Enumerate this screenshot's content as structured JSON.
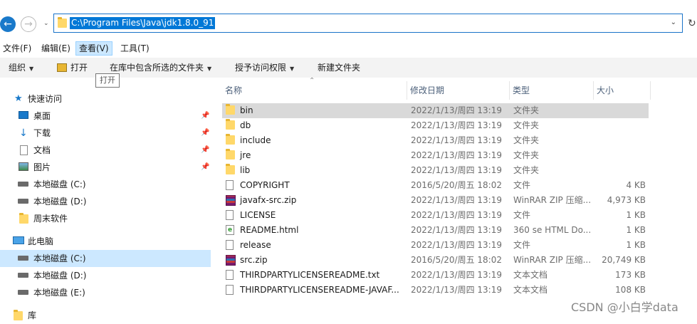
{
  "address": {
    "path": "C:\\Program Files\\Java\\jdk1.8.0_91"
  },
  "menu": {
    "items": [
      "文件(F)",
      "编辑(E)",
      "查看(V)",
      "工具(T)"
    ]
  },
  "command_bar": {
    "organize": "组织",
    "open": "打开",
    "include_in_library": "在库中包含所选的文件夹",
    "grant_access": "授予访问权限",
    "new_folder": "新建文件夹",
    "tooltip": "打开"
  },
  "nav": {
    "quick_access": "快速访问",
    "desktop": "桌面",
    "downloads": "下载",
    "documents": "文档",
    "pictures": "图片",
    "qa_drive_c": "本地磁盘 (C:)",
    "qa_drive_d": "本地磁盘 (D:)",
    "weekend": "周末软件",
    "this_pc": "此电脑",
    "drive_c": "本地磁盘 (C:)",
    "drive_d": "本地磁盘 (D:)",
    "drive_e": "本地磁盘 (E:)",
    "library": "库"
  },
  "columns": {
    "name": "名称",
    "date": "修改日期",
    "type": "类型",
    "size": "大小"
  },
  "files": [
    {
      "name": "bin",
      "date": "2022/1/13/周四 13:19",
      "type": "文件夹",
      "size": "",
      "icon": "folder-icon"
    },
    {
      "name": "db",
      "date": "2022/1/13/周四 13:19",
      "type": "文件夹",
      "size": "",
      "icon": "folder-icon"
    },
    {
      "name": "include",
      "date": "2022/1/13/周四 13:19",
      "type": "文件夹",
      "size": "",
      "icon": "folder-icon"
    },
    {
      "name": "jre",
      "date": "2022/1/13/周四 13:19",
      "type": "文件夹",
      "size": "",
      "icon": "folder-icon"
    },
    {
      "name": "lib",
      "date": "2022/1/13/周四 13:19",
      "type": "文件夹",
      "size": "",
      "icon": "folder-icon"
    },
    {
      "name": "COPYRIGHT",
      "date": "2016/5/20/周五 18:02",
      "type": "文件",
      "size": "4 KB",
      "icon": "file-icon"
    },
    {
      "name": "javafx-src.zip",
      "date": "2022/1/13/周四 13:19",
      "type": "WinRAR ZIP 压缩...",
      "size": "4,973 KB",
      "icon": "zip-icon"
    },
    {
      "name": "LICENSE",
      "date": "2022/1/13/周四 13:19",
      "type": "文件",
      "size": "1 KB",
      "icon": "file-icon"
    },
    {
      "name": "README.html",
      "date": "2022/1/13/周四 13:19",
      "type": "360 se HTML Do...",
      "size": "1 KB",
      "icon": "html-icon"
    },
    {
      "name": "release",
      "date": "2022/1/13/周四 13:19",
      "type": "文件",
      "size": "1 KB",
      "icon": "file-icon"
    },
    {
      "name": "src.zip",
      "date": "2016/5/20/周五 18:02",
      "type": "WinRAR ZIP 压缩...",
      "size": "20,749 KB",
      "icon": "zip-icon"
    },
    {
      "name": "THIRDPARTYLICENSEREADME.txt",
      "date": "2022/1/13/周四 13:19",
      "type": "文本文档",
      "size": "173 KB",
      "icon": "text-file-icon"
    },
    {
      "name": "THIRDPARTYLICENSEREADME-JAVAF...",
      "date": "2022/1/13/周四 13:19",
      "type": "文本文档",
      "size": "108 KB",
      "icon": "text-file-icon"
    }
  ],
  "watermark": "CSDN @小白学data"
}
